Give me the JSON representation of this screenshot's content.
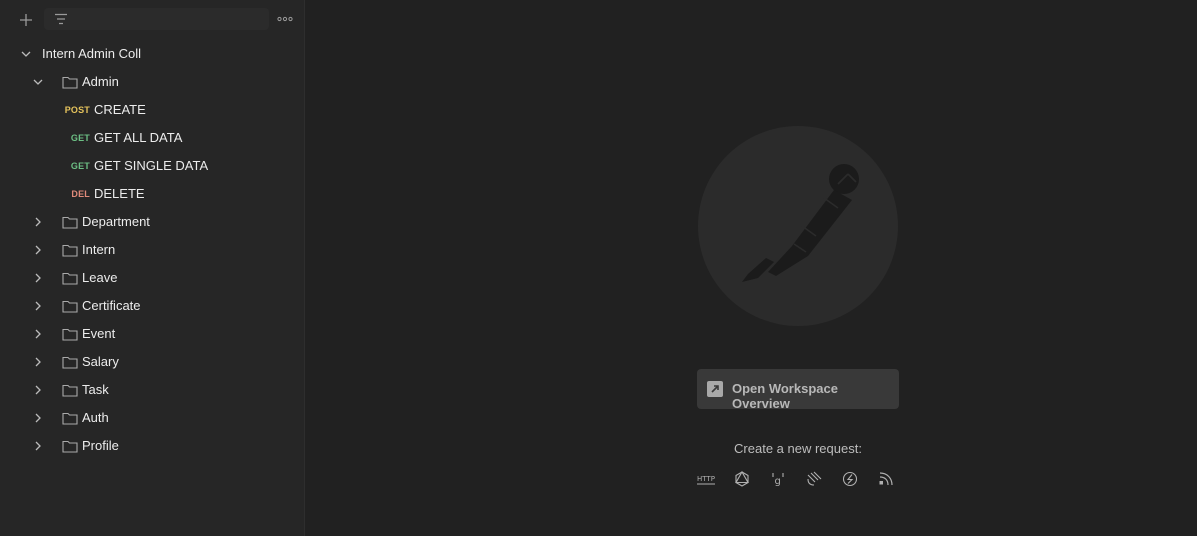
{
  "toolbar": {
    "add_icon": "plus-icon",
    "filter_icon": "filter-icon",
    "search_value": "",
    "more_icon": "more-horizontal-icon"
  },
  "collection": {
    "name": "Intern Admin Coll",
    "folders": [
      {
        "name": "Admin",
        "expanded": true,
        "requests": [
          {
            "method": "POST",
            "name": "CREATE"
          },
          {
            "method": "GET",
            "name": "GET ALL DATA"
          },
          {
            "method": "GET",
            "name": "GET SINGLE DATA"
          },
          {
            "method": "DEL",
            "name": "DELETE"
          }
        ]
      },
      {
        "name": "Department",
        "expanded": false
      },
      {
        "name": "Intern",
        "expanded": false
      },
      {
        "name": "Leave",
        "expanded": false
      },
      {
        "name": "Certificate",
        "expanded": false
      },
      {
        "name": "Event",
        "expanded": false
      },
      {
        "name": "Salary",
        "expanded": false
      },
      {
        "name": "Task",
        "expanded": false
      },
      {
        "name": "Auth",
        "expanded": false
      },
      {
        "name": "Profile",
        "expanded": false
      }
    ]
  },
  "main": {
    "logo_icon": "postman-astronaut-logo",
    "overview_button": "Open Workspace Overview",
    "create_label": "Create a new request:",
    "request_types": [
      {
        "icon": "http-icon",
        "name": "HTTP"
      },
      {
        "icon": "graphql-icon",
        "name": "GraphQL"
      },
      {
        "icon": "grpc-icon",
        "name": "gRPC"
      },
      {
        "icon": "websocket-icon",
        "name": "WebSocket"
      },
      {
        "icon": "socketio-icon",
        "name": "Socket.IO"
      },
      {
        "icon": "mqtt-icon",
        "name": "MQTT"
      }
    ]
  },
  "colors": {
    "background": "#212121",
    "sidebar": "#262626",
    "post": "#e5c35c",
    "get": "#6cbf84",
    "delete": "#e08a7a"
  }
}
